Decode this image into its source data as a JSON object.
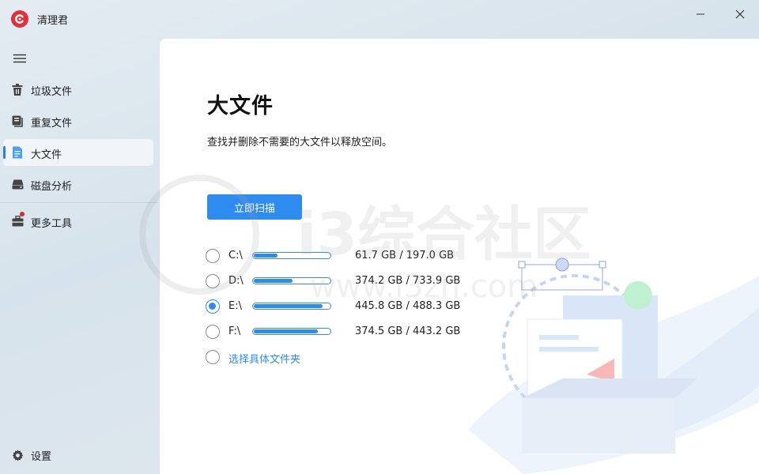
{
  "app": {
    "title": "清理君",
    "brand_color": "#e0303a",
    "accent_color": "#2e8cf0"
  },
  "window_controls": {
    "minimize_icon": "minimize-icon",
    "close_icon": "close-icon"
  },
  "sidebar": {
    "menu_icon": "hamburger-menu-icon",
    "items": [
      {
        "label": "垃圾文件",
        "icon": "trash-icon",
        "active": false
      },
      {
        "label": "重复文件",
        "icon": "duplicate-files-icon",
        "active": false
      },
      {
        "label": "大文件",
        "icon": "large-file-icon",
        "active": true
      },
      {
        "label": "磁盘分析",
        "icon": "disk-icon",
        "active": false
      },
      {
        "label": "更多工具",
        "icon": "toolbox-icon",
        "active": false,
        "badge": "red-dot"
      }
    ],
    "settings": {
      "label": "设置",
      "icon": "gear-icon"
    }
  },
  "main": {
    "title": "大文件",
    "description": "查找并删除不需要的大文件以释放空间。",
    "scan_button": "立即扫描",
    "drives": [
      {
        "label": "C:\\",
        "used_fraction": 0.31,
        "size_text": "61.7 GB / 197.0 GB",
        "selected": false
      },
      {
        "label": "D:\\",
        "used_fraction": 0.51,
        "size_text": "374.2 GB / 733.9 GB",
        "selected": false
      },
      {
        "label": "E:\\",
        "used_fraction": 0.91,
        "size_text": "445.8 GB / 488.3 GB",
        "selected": true
      },
      {
        "label": "F:\\",
        "used_fraction": 0.84,
        "size_text": "374.5 GB / 443.2 GB",
        "selected": false
      }
    ],
    "choose_folder": "选择具体文件夹"
  },
  "watermark": {
    "text_large": "i3综合社区",
    "text_url": "www.i3zh.com"
  }
}
